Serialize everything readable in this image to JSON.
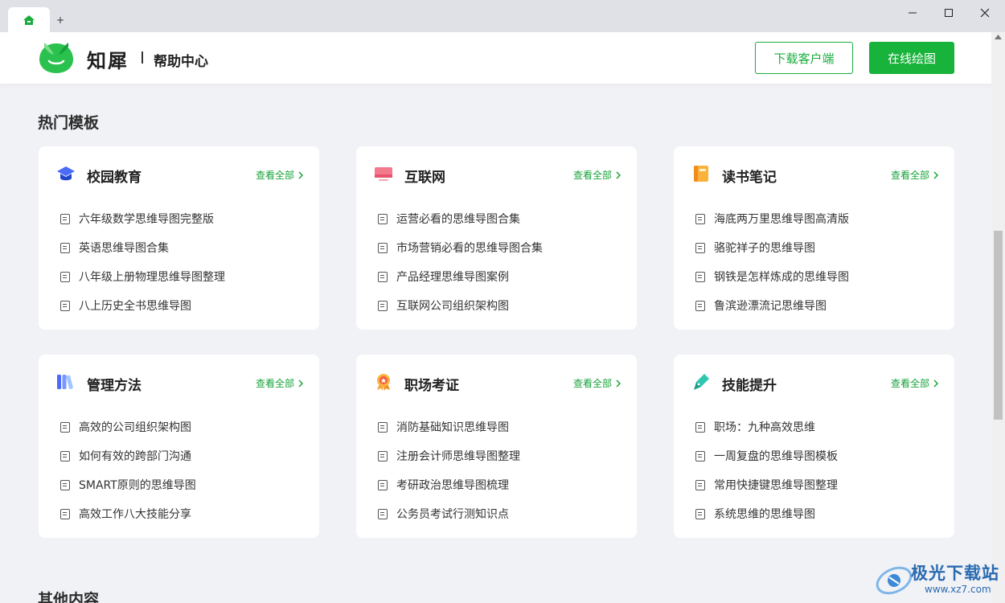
{
  "titlebar": {
    "add_tab": "+",
    "minimize": "─",
    "maximize": "☐",
    "close": "✕"
  },
  "header": {
    "brand": "知犀",
    "subtitle": "帮助中心",
    "download_button": "下载客户端",
    "online_button": "在线绘图"
  },
  "sections": {
    "hot_templates": "热门模板",
    "other_content": "其他内容"
  },
  "colors": {
    "accent": "#17b33a",
    "link": "#17a33a"
  },
  "cards": [
    {
      "title": "校园教育",
      "icon": "graduation-cap-icon",
      "more": "查看全部",
      "items": [
        "六年级数学思维导图完整版",
        "英语思维导图合集",
        "八年级上册物理思维导图整理",
        "八上历史全书思维导图"
      ]
    },
    {
      "title": "互联网",
      "icon": "monitor-icon",
      "more": "查看全部",
      "items": [
        "运营必看的思维导图合集",
        "市场营销必看的思维导图合集",
        "产品经理思维导图案例",
        "互联网公司组织架构图"
      ]
    },
    {
      "title": "读书笔记",
      "icon": "notebook-icon",
      "more": "查看全部",
      "items": [
        "海底两万里思维导图高清版",
        "骆驼祥子的思维导图",
        "钢铁是怎样炼成的思维导图",
        "鲁滨逊漂流记思维导图"
      ]
    },
    {
      "title": "管理方法",
      "icon": "books-icon",
      "more": "查看全部",
      "items": [
        "高效的公司组织架构图",
        "如何有效的跨部门沟通",
        "SMART原则的思维导图",
        "高效工作八大技能分享"
      ]
    },
    {
      "title": "职场考证",
      "icon": "medal-icon",
      "more": "查看全部",
      "items": [
        "消防基础知识思维导图",
        "注册会计师思维导图整理",
        "考研政治思维导图梳理",
        "公务员考试行测知识点"
      ]
    },
    {
      "title": "技能提升",
      "icon": "pen-icon",
      "more": "查看全部",
      "items": [
        "职场：九种高效思维",
        "一周复盘的思维导图模板",
        "常用快捷键思维导图整理",
        "系统思维的思维导图"
      ]
    }
  ],
  "watermark": {
    "text": "极光下载站",
    "url": "www.xz7.com"
  }
}
